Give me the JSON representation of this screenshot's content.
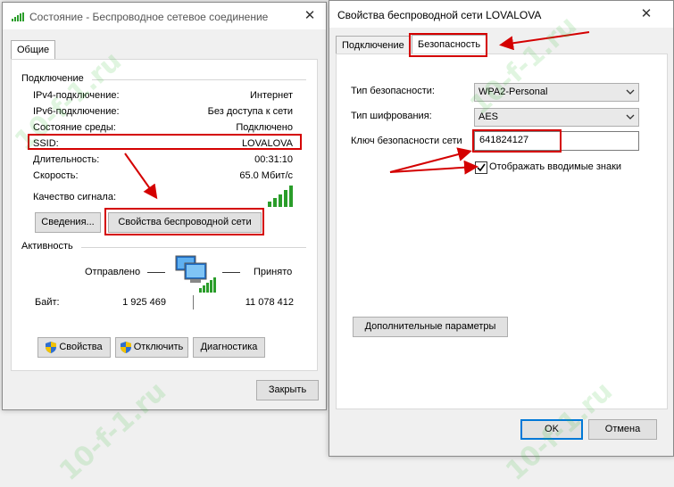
{
  "status_window": {
    "title": "Состояние - Беспроводное сетевое соединение",
    "close_glyph": "✕",
    "tab_general": "Общие",
    "connection_group": "Подключение",
    "rows": [
      {
        "label": "IPv4-подключение:",
        "value": "Интернет"
      },
      {
        "label": "IPv6-подключение:",
        "value": "Без доступа к сети"
      },
      {
        "label": "Состояние среды:",
        "value": "Подключено"
      },
      {
        "label": "SSID:",
        "value": "LOVALOVA"
      },
      {
        "label": "Длительность:",
        "value": "00:31:10"
      },
      {
        "label": "Скорость:",
        "value": "65.0 Мбит/с"
      }
    ],
    "signal_quality_label": "Качество сигнала:",
    "signal_level": "5/5",
    "details_button": "Сведения...",
    "wireless_props_button": "Свойства беспроводной сети",
    "activity_group": "Активность",
    "sent_label": "Отправлено",
    "received_label": "Принято",
    "bytes_label": "Байт:",
    "bytes_sent": "1 925 469",
    "bytes_received": "11 078 412",
    "properties_button": "Свойства",
    "disable_button": "Отключить",
    "diagnose_button": "Диагностика",
    "close_button": "Закрыть"
  },
  "props_window": {
    "title": "Свойства беспроводной сети LOVALOVA",
    "close_glyph": "✕",
    "tab_connection": "Подключение",
    "tab_security": "Безопасность",
    "security_type_label": "Тип безопасности:",
    "security_type_value": "WPA2-Personal",
    "encryption_label": "Тип шифрования:",
    "encryption_value": "AES",
    "key_label": "Ключ безопасности сети",
    "key_value": "641824127",
    "show_chars_label": "Отображать вводимые знаки",
    "show_chars_checked": true,
    "advanced_button": "Дополнительные параметры",
    "ok_button": "OK",
    "cancel_button": "Отмена"
  },
  "watermark": "10-f-1.ru",
  "colors": {
    "highlight_red": "#d40000",
    "signal_green": "#2a9d2a",
    "shield_blue": "#2f6fd0",
    "shield_yellow": "#f2c200",
    "focus_blue": "#0078d7"
  }
}
